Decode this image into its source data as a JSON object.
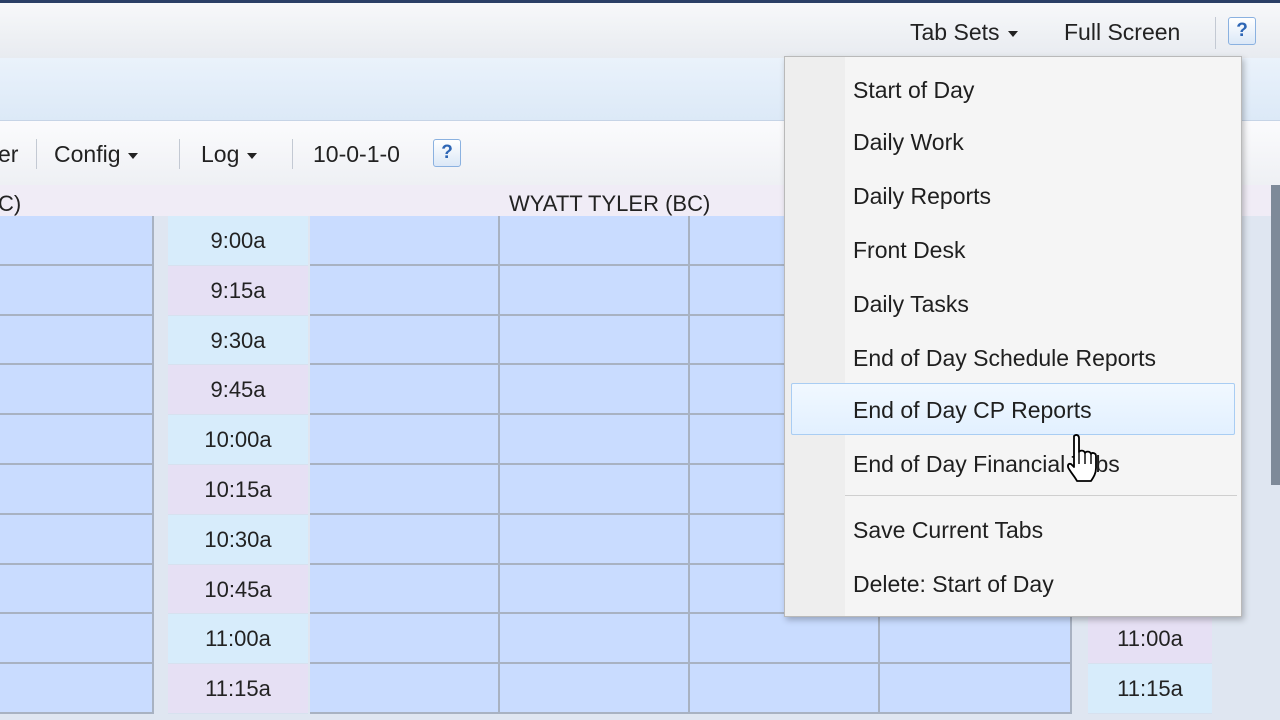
{
  "topbar": {
    "tab_sets_label": "Tab Sets",
    "full_screen_label": "Full Screen",
    "help_symbol": "?"
  },
  "toolbar": {
    "partial_item": "er",
    "config_label": "Config",
    "log_label": "Log",
    "version": "10-0-1-0",
    "help_symbol": "?"
  },
  "schedule": {
    "left_provider_partial": "C)",
    "provider_name": "WYATT TYLER (BC)",
    "times": [
      "9:00a",
      "9:15a",
      "9:30a",
      "9:45a",
      "10:00a",
      "10:15a",
      "10:30a",
      "10:45a",
      "11:00a",
      "11:15a"
    ],
    "right_times": [
      "11:00a",
      "11:15a"
    ]
  },
  "tab_sets_menu": {
    "items": [
      "Start of Day",
      "Daily Work",
      "Daily Reports",
      "Front Desk",
      "Daily Tasks",
      "End of Day Schedule Reports",
      "End of Day CP Reports",
      "End of Day Financial Tabs"
    ],
    "actions": [
      "Save Current Tabs",
      "Delete: Start of Day"
    ],
    "highlighted_index": 6
  }
}
